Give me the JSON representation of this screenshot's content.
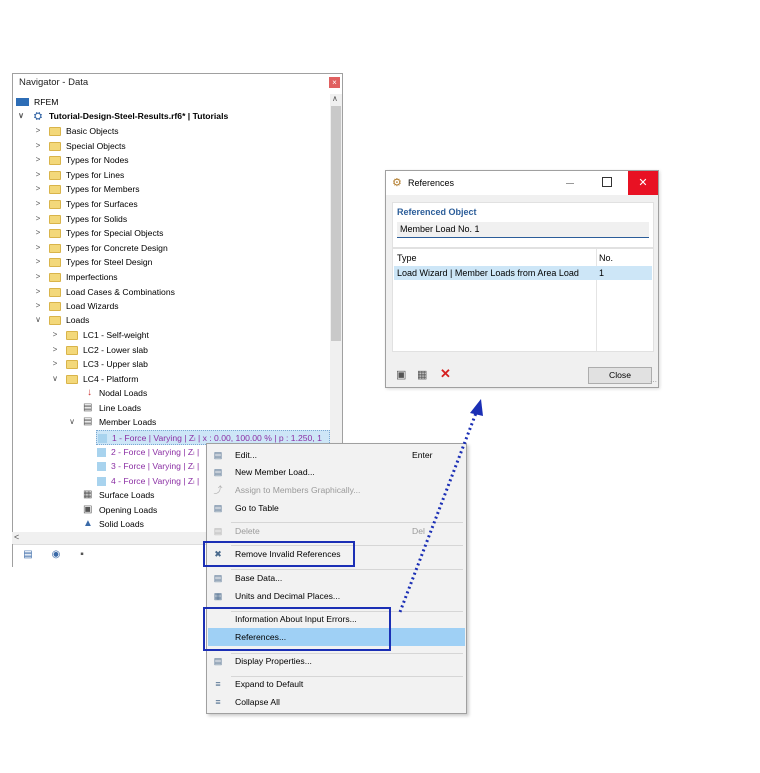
{
  "navigator": {
    "title": "Navigator - Data",
    "close_glyph": "×",
    "root": "RFEM",
    "project": "Tutorial-Design-Steel-Results.rf6* | Tutorials",
    "folders": [
      "Basic Objects",
      "Special Objects",
      "Types for Nodes",
      "Types for Lines",
      "Types for Members",
      "Types for Surfaces",
      "Types for Solids",
      "Types for Special Objects",
      "Types for Concrete Design",
      "Types for Steel Design",
      "Imperfections",
      "Load Cases & Combinations",
      "Load Wizards"
    ],
    "loads_label": "Loads",
    "load_cases": [
      "LC1 - Self-weight",
      "LC2 - Lower slab",
      "LC3 - Upper slab",
      "LC4 - Platform"
    ],
    "lc4_children": [
      "Nodal Loads",
      "Line Loads",
      "Member Loads"
    ],
    "member_loads": [
      "1 - Force | Varying | Zₗ | x : 0.00, 100.00 % | p : 1.250, 1",
      "2 - Force | Varying | Zₗ |",
      "3 - Force | Varying | Zₗ |",
      "4 - Force | Varying | Zₗ |"
    ],
    "after_items": [
      "Surface Loads",
      "Opening Loads",
      "Solid Loads"
    ],
    "bottom_tabs": [
      "data-icon",
      "eye-icon",
      "video-icon"
    ]
  },
  "context_menu": {
    "items": [
      {
        "label": "Edit...",
        "key": "Enter",
        "enabled": true
      },
      {
        "label": "New Member Load...",
        "key": "",
        "enabled": true
      },
      {
        "label": "Assign to Members Graphically...",
        "key": "",
        "enabled": false
      },
      {
        "label": "Go to Table",
        "key": "",
        "enabled": true
      },
      {
        "label": "Delete",
        "key": "Del",
        "enabled": false
      },
      {
        "label": "Remove Invalid References",
        "key": "",
        "enabled": true
      },
      {
        "label": "Base Data...",
        "key": "",
        "enabled": true
      },
      {
        "label": "Units and Decimal Places...",
        "key": "",
        "enabled": true
      },
      {
        "label": "Information About Input Errors...",
        "key": "",
        "enabled": true
      },
      {
        "label": "References...",
        "key": "",
        "enabled": true
      },
      {
        "label": "Display Properties...",
        "key": "",
        "enabled": true
      },
      {
        "label": "Expand to Default",
        "key": "",
        "enabled": true
      },
      {
        "label": "Collapse All",
        "key": "",
        "enabled": true
      }
    ]
  },
  "references_dialog": {
    "title": "References",
    "referenced_object_label": "Referenced Object",
    "referenced_object_value": "Member Load No. 1",
    "col_type": "Type",
    "col_no": "No.",
    "rows": [
      {
        "type": "Load Wizard | Member Loads from Area Load",
        "no": "1"
      }
    ],
    "close_label": "Close",
    "title_close_glyph": "✕"
  },
  "colors": {
    "highlight_box": "#1b2fb5",
    "arrow": "#1b2fb5",
    "menu_highlight": "#9fd0f5",
    "purple_text": "#8b2fa4"
  }
}
